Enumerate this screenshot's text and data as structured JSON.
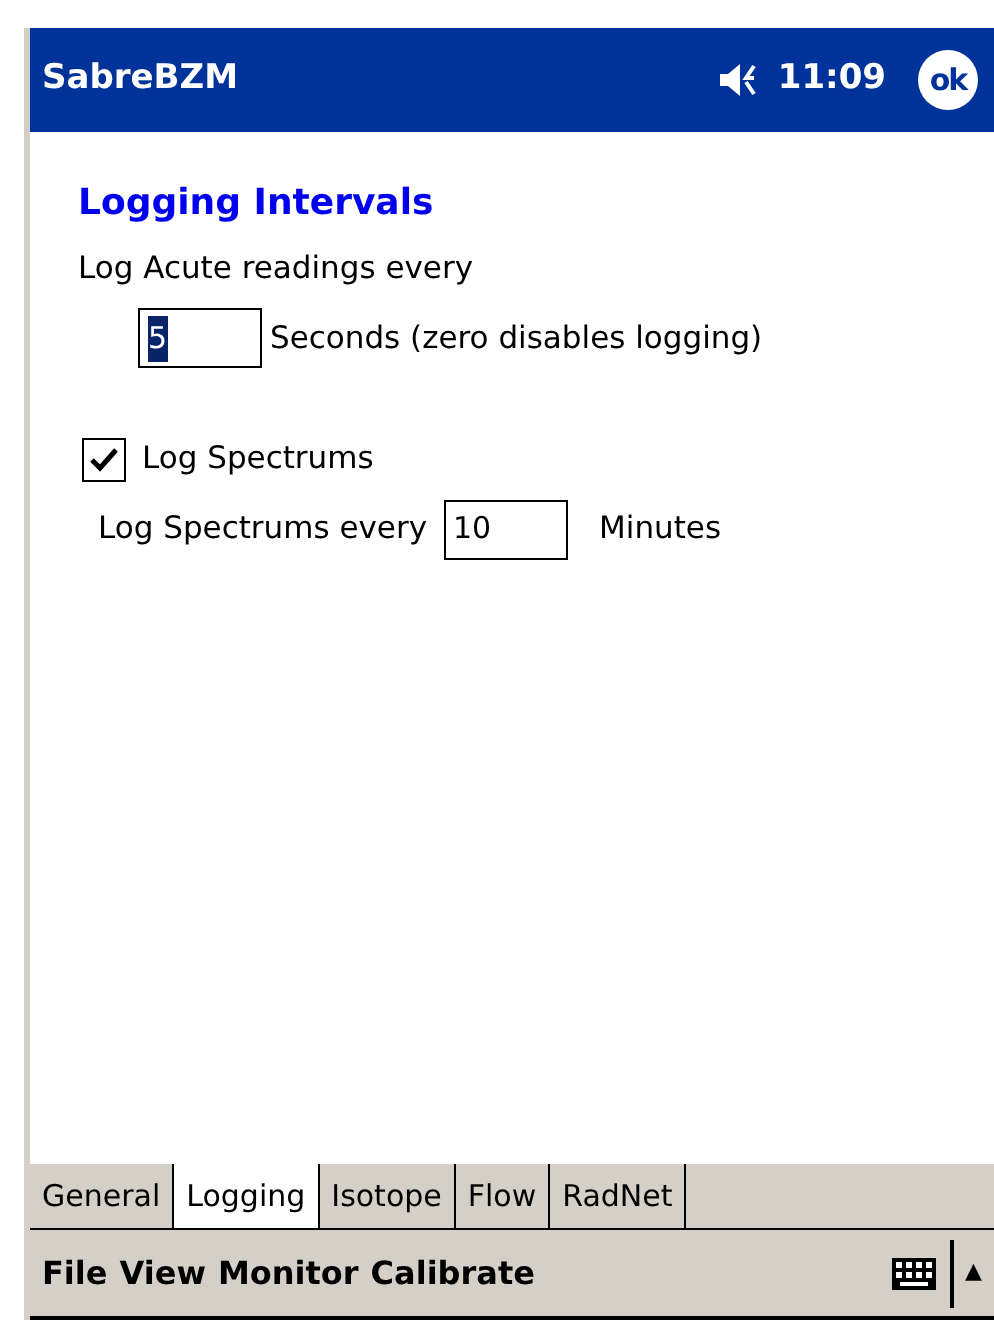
{
  "title_bar": {
    "title": "SabreBZM",
    "time": "11:09",
    "ok": "ok"
  },
  "heading": "Logging Intervals",
  "acute": {
    "label": "Log Acute readings every",
    "value": "5",
    "text_selected": true,
    "unit": "Seconds (zero disables logging)"
  },
  "spectrum_checkbox": {
    "label": "Log Spectrums",
    "checked": true
  },
  "spectrum_interval": {
    "label": "Log Spectrums every",
    "value": "10",
    "text_selected": false,
    "unit": "Minutes"
  },
  "tabs": [
    {
      "label": "General",
      "selected": false
    },
    {
      "label": "Logging",
      "selected": true
    },
    {
      "label": "Isotope",
      "selected": false
    },
    {
      "label": "Flow",
      "selected": false
    },
    {
      "label": "RadNet",
      "selected": false
    }
  ],
  "menu": [
    "File",
    "View",
    "Monitor",
    "Calibrate"
  ],
  "sip_arrow": "▲"
}
